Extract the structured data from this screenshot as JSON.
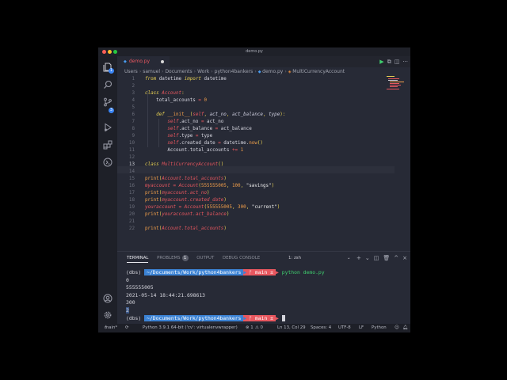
{
  "window": {
    "title": "demo.py"
  },
  "activity_bar": {
    "explorer_badge": "1",
    "scm_badge": "3"
  },
  "tab": {
    "label": "demo.py"
  },
  "breadcrumbs": [
    "Users",
    "samuel",
    "Documents",
    "Work",
    "python4bankers",
    "demo.py",
    "MultiCurrencyAccount"
  ],
  "editor": {
    "line_numbers": [
      "1",
      "2",
      "3",
      "4",
      "5",
      "6",
      "7",
      "8",
      "9",
      "10",
      "11",
      "12",
      "13",
      "14",
      "15",
      "16",
      "17",
      "18",
      "19",
      "20",
      "21",
      "22"
    ],
    "current_line": "13"
  },
  "panel": {
    "tabs": [
      "TERMINAL",
      "PROBLEMS",
      "OUTPUT",
      "DEBUG CONSOLE"
    ],
    "problems_count": "1",
    "terminal_select": "1: zsh",
    "terminal_lines": {
      "prompt_env_1": "(dbs)",
      "prompt_path_1": "~/Documents/Work/python4bankers",
      "prompt_git_1": "ᚠ main ±",
      "command_1": "python demo.py",
      "out_1": "0",
      "out_2": "555555005",
      "out_3": "2021-05-14 18:44:21.698613",
      "out_4": "300",
      "out_5": "2",
      "prompt_env_2": "(dbs)",
      "prompt_path_2": "~/Documents/Work/python4bankers",
      "prompt_git_2": "ᚠ main ±"
    }
  },
  "status_bar": {
    "branch": "main*",
    "interpreter": "Python 3.9.1 64-bit ('cv': virtualenvwrapper)",
    "errors": "⊗ 1",
    "warnings": "⚠ 0",
    "position": "Ln 13, Col 29",
    "spaces": "Spaces: 4",
    "encoding": "UTF-8",
    "eol": "LF",
    "language": "Python"
  },
  "colors": {
    "accent_blue": "#3b82d4",
    "git_red": "#e8575f",
    "run_green": "#3fce6e"
  },
  "icons": [
    "explorer-icon",
    "search-icon",
    "source-control-icon",
    "run-debug-icon",
    "extensions-icon",
    "remote-icon",
    "account-icon",
    "settings-icon"
  ]
}
